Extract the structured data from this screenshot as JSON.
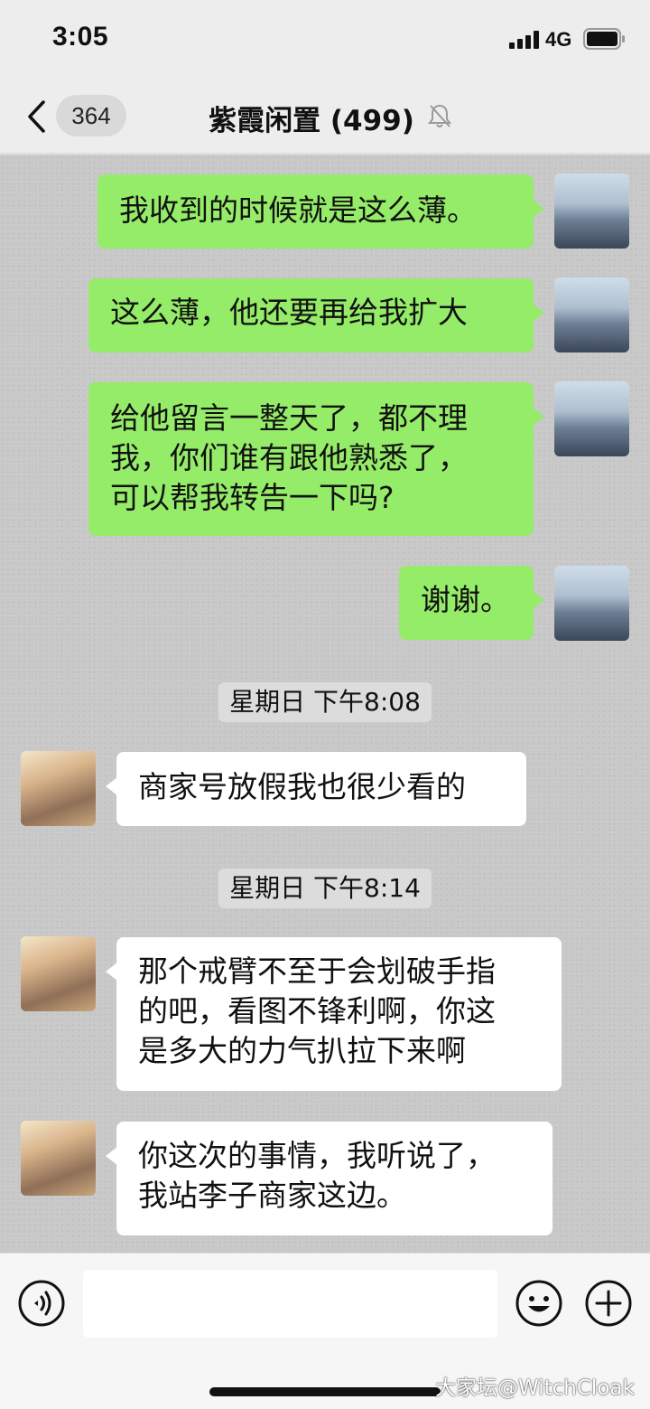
{
  "status_bar": {
    "time": "3:05",
    "network": "4G"
  },
  "nav": {
    "unread_count": "364",
    "title": "紫霞闲置 (499)"
  },
  "messages": [
    {
      "side": "me",
      "text": "我收到的时候就是这么薄。"
    },
    {
      "side": "me",
      "text": "这么薄，他还要再给我扩大"
    },
    {
      "side": "me",
      "text": "给他留言一整天了，都不理\n我，你们谁有跟他熟悉了，\n可以帮我转告一下吗?"
    },
    {
      "side": "me",
      "text": "谢谢。"
    },
    {
      "type": "timestamp",
      "text": "星期日 下午8:08"
    },
    {
      "side": "them",
      "text": "商家号放假我也很少看的"
    },
    {
      "type": "timestamp",
      "text": "星期日 下午8:14"
    },
    {
      "side": "them",
      "text": "那个戒臂不至于会划破手指\n的吧，看图不锋利啊，你这\n是多大的力气扒拉下来啊"
    },
    {
      "side": "them",
      "text": "你这次的事情，我听说了，\n我站李子商家这边。"
    }
  ],
  "input": {
    "value": "",
    "placeholder": ""
  },
  "watermark": "大家坛@WitchCloak",
  "colors": {
    "my_bubble": "#95ec69",
    "their_bubble": "#ffffff",
    "background": "#c8c8c8"
  },
  "icons": [
    "back-icon",
    "mute-icon",
    "signal-icon",
    "battery-icon",
    "voice-icon",
    "emoji-icon",
    "plus-icon"
  ]
}
